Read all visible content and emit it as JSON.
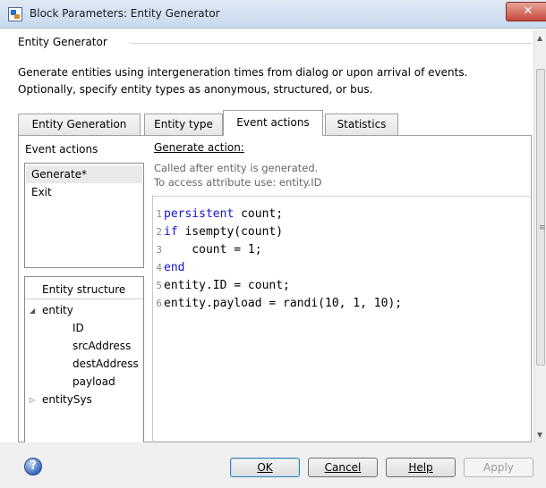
{
  "window": {
    "title": "Block Parameters: Entity Generator",
    "close_glyph": "✕"
  },
  "block": {
    "group_label": "Entity Generator",
    "description_lines": [
      "Generate entities using intergeneration times from dialog or upon arrival of events.",
      "Optionally, specify entity types as anonymous, structured, or bus."
    ]
  },
  "tabs": [
    {
      "label": "Entity Generation",
      "active": false
    },
    {
      "label": "Entity type",
      "active": false
    },
    {
      "label": "Event actions",
      "active": true
    },
    {
      "label": "Statistics",
      "active": false
    }
  ],
  "event_actions": {
    "title": "Event actions",
    "items": [
      {
        "label": "Generate*",
        "selected": true
      },
      {
        "label": "Exit",
        "selected": false
      }
    ]
  },
  "entity_structure": {
    "title": "Entity structure",
    "tree": [
      {
        "label": "entity",
        "expanded": true,
        "children": [
          "ID",
          "srcAddress",
          "destAddress",
          "payload"
        ]
      },
      {
        "label": "entitySys",
        "expanded": false,
        "children": []
      }
    ]
  },
  "editor": {
    "title": "Generate action:",
    "hint_lines": [
      "Called after entity is generated.",
      "To access attribute use: entity.ID"
    ],
    "code_lines": [
      {
        "num": "1",
        "kw": "persistent",
        "rest": " count;"
      },
      {
        "num": "2",
        "kw": "if",
        "rest": " isempty(count)"
      },
      {
        "num": "3",
        "kw": "",
        "rest": "    count = 1;"
      },
      {
        "num": "4",
        "kw": "end",
        "rest": ""
      },
      {
        "num": "5",
        "kw": "",
        "rest": "entity.ID = count;"
      },
      {
        "num": "6",
        "kw": "",
        "rest": "entity.payload = randi(10, 1, 10);"
      }
    ]
  },
  "buttons": {
    "help_icon": "?",
    "ok": "OK",
    "cancel": "Cancel",
    "help": "Help",
    "apply": "Apply"
  },
  "icons": {
    "app": "block-parameters-icon",
    "scroll_up": "▲",
    "scroll_down": "▼",
    "grip": "≡",
    "tree_expanded": "◢",
    "tree_collapsed": "▷"
  },
  "colors": {
    "keyword": "#1414d2",
    "titlebar": "#c8d9ee",
    "close": "#c7473a"
  }
}
